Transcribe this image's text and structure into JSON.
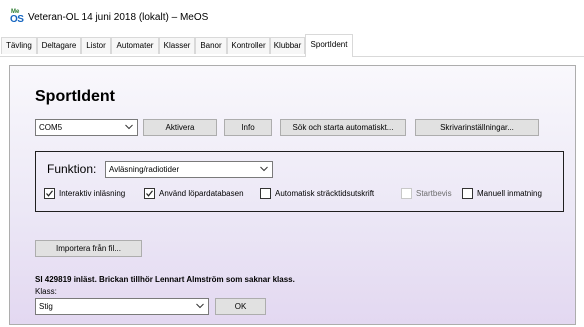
{
  "window": {
    "logo_top": "Me",
    "logo_bottom": "OS",
    "title": "Veteran-OL 14 juni 2018 (lokalt) – MeOS"
  },
  "tabs": [
    {
      "label": "Tävling",
      "active": false
    },
    {
      "label": "Deltagare",
      "active": false
    },
    {
      "label": "Listor",
      "active": false
    },
    {
      "label": "Automater",
      "active": false
    },
    {
      "label": "Klasser",
      "active": false
    },
    {
      "label": "Banor",
      "active": false
    },
    {
      "label": "Kontroller",
      "active": false
    },
    {
      "label": "Klubbar",
      "active": false
    },
    {
      "label": "SportIdent",
      "active": true
    }
  ],
  "sportident": {
    "heading": "SportIdent",
    "port_select": {
      "value": "COM5"
    },
    "buttons": {
      "activate": "Aktivera",
      "info": "Info",
      "search_start": "Sök och starta automatiskt...",
      "printer_settings": "Skrivarinställningar..."
    },
    "function": {
      "label": "Funktion:",
      "value": "Avläsning/radiotider"
    },
    "checkboxes": [
      {
        "label": "Interaktiv inläsning",
        "checked": true,
        "enabled": true
      },
      {
        "label": "Använd löpardatabasen",
        "checked": true,
        "enabled": true
      },
      {
        "label": "Automatisk sträcktidsutskrift",
        "checked": false,
        "enabled": true
      },
      {
        "label": "Startbevis",
        "checked": false,
        "enabled": false
      },
      {
        "label": "Manuell inmatning",
        "checked": false,
        "enabled": true
      }
    ],
    "import_button": "Importera från fil...",
    "status": "SI 429819 inläst. Brickan tillhör Lennart Almström som saknar klass.",
    "class_label": "Klass:",
    "class_select": {
      "value": "Stig"
    },
    "ok_button": "OK"
  }
}
